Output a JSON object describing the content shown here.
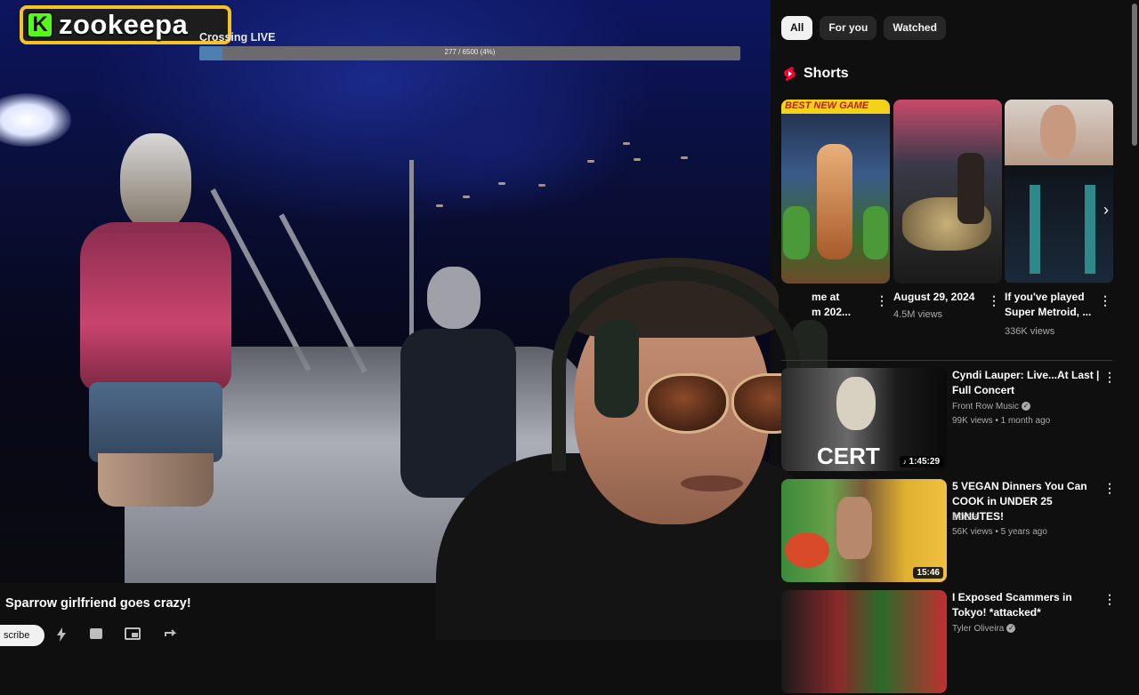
{
  "stream_overlay": {
    "brand": "zookeepa",
    "brand_initial": "K",
    "goal_title": "Crossing LIVE",
    "goal_progress_text": "277 / 6500 (4%)",
    "goal_progress_fraction": 0.0426
  },
  "video": {
    "title": "Sparrow girlfriend goes crazy!",
    "subscribe_label": "scribe"
  },
  "chips": [
    {
      "label": "All",
      "active": true
    },
    {
      "label": "For you",
      "active": false
    },
    {
      "label": "Watched",
      "active": false
    }
  ],
  "shorts": {
    "label": "Shorts",
    "items": [
      {
        "title": "me at\nm 202...",
        "views": "",
        "thumb_text": "BEST NEW GAME"
      },
      {
        "title": "August 29, 2024",
        "views": "4.5M views",
        "thumb_text": ""
      },
      {
        "title": "If you've played Super Metroid, ...",
        "views": "336K views",
        "thumb_text": ""
      }
    ]
  },
  "recommendations": [
    {
      "title": "Cyndi Lauper: Live...At Last | Full Concert",
      "channel": "Front Row Music",
      "verified": true,
      "meta": "99K views • 1 month ago",
      "duration": "1:45:29",
      "thumb_text": "CERT"
    },
    {
      "title": "5 VEGAN Dinners You Can COOK in UNDER 25 MINUTES!",
      "channel": "BOSH!",
      "verified": false,
      "meta": "56K views • 5 years ago",
      "duration": "15:46",
      "thumb_text": ""
    },
    {
      "title": "I Exposed Scammers in Tokyo! *attacked*",
      "channel": "Tyler Oliveira",
      "verified": true,
      "meta": "",
      "duration": "",
      "thumb_text": ""
    }
  ],
  "colors": {
    "kick_green": "#53fc18",
    "logo_border": "#f6c324",
    "shorts_red": "#ff0033",
    "background": "#0f0f0f"
  }
}
